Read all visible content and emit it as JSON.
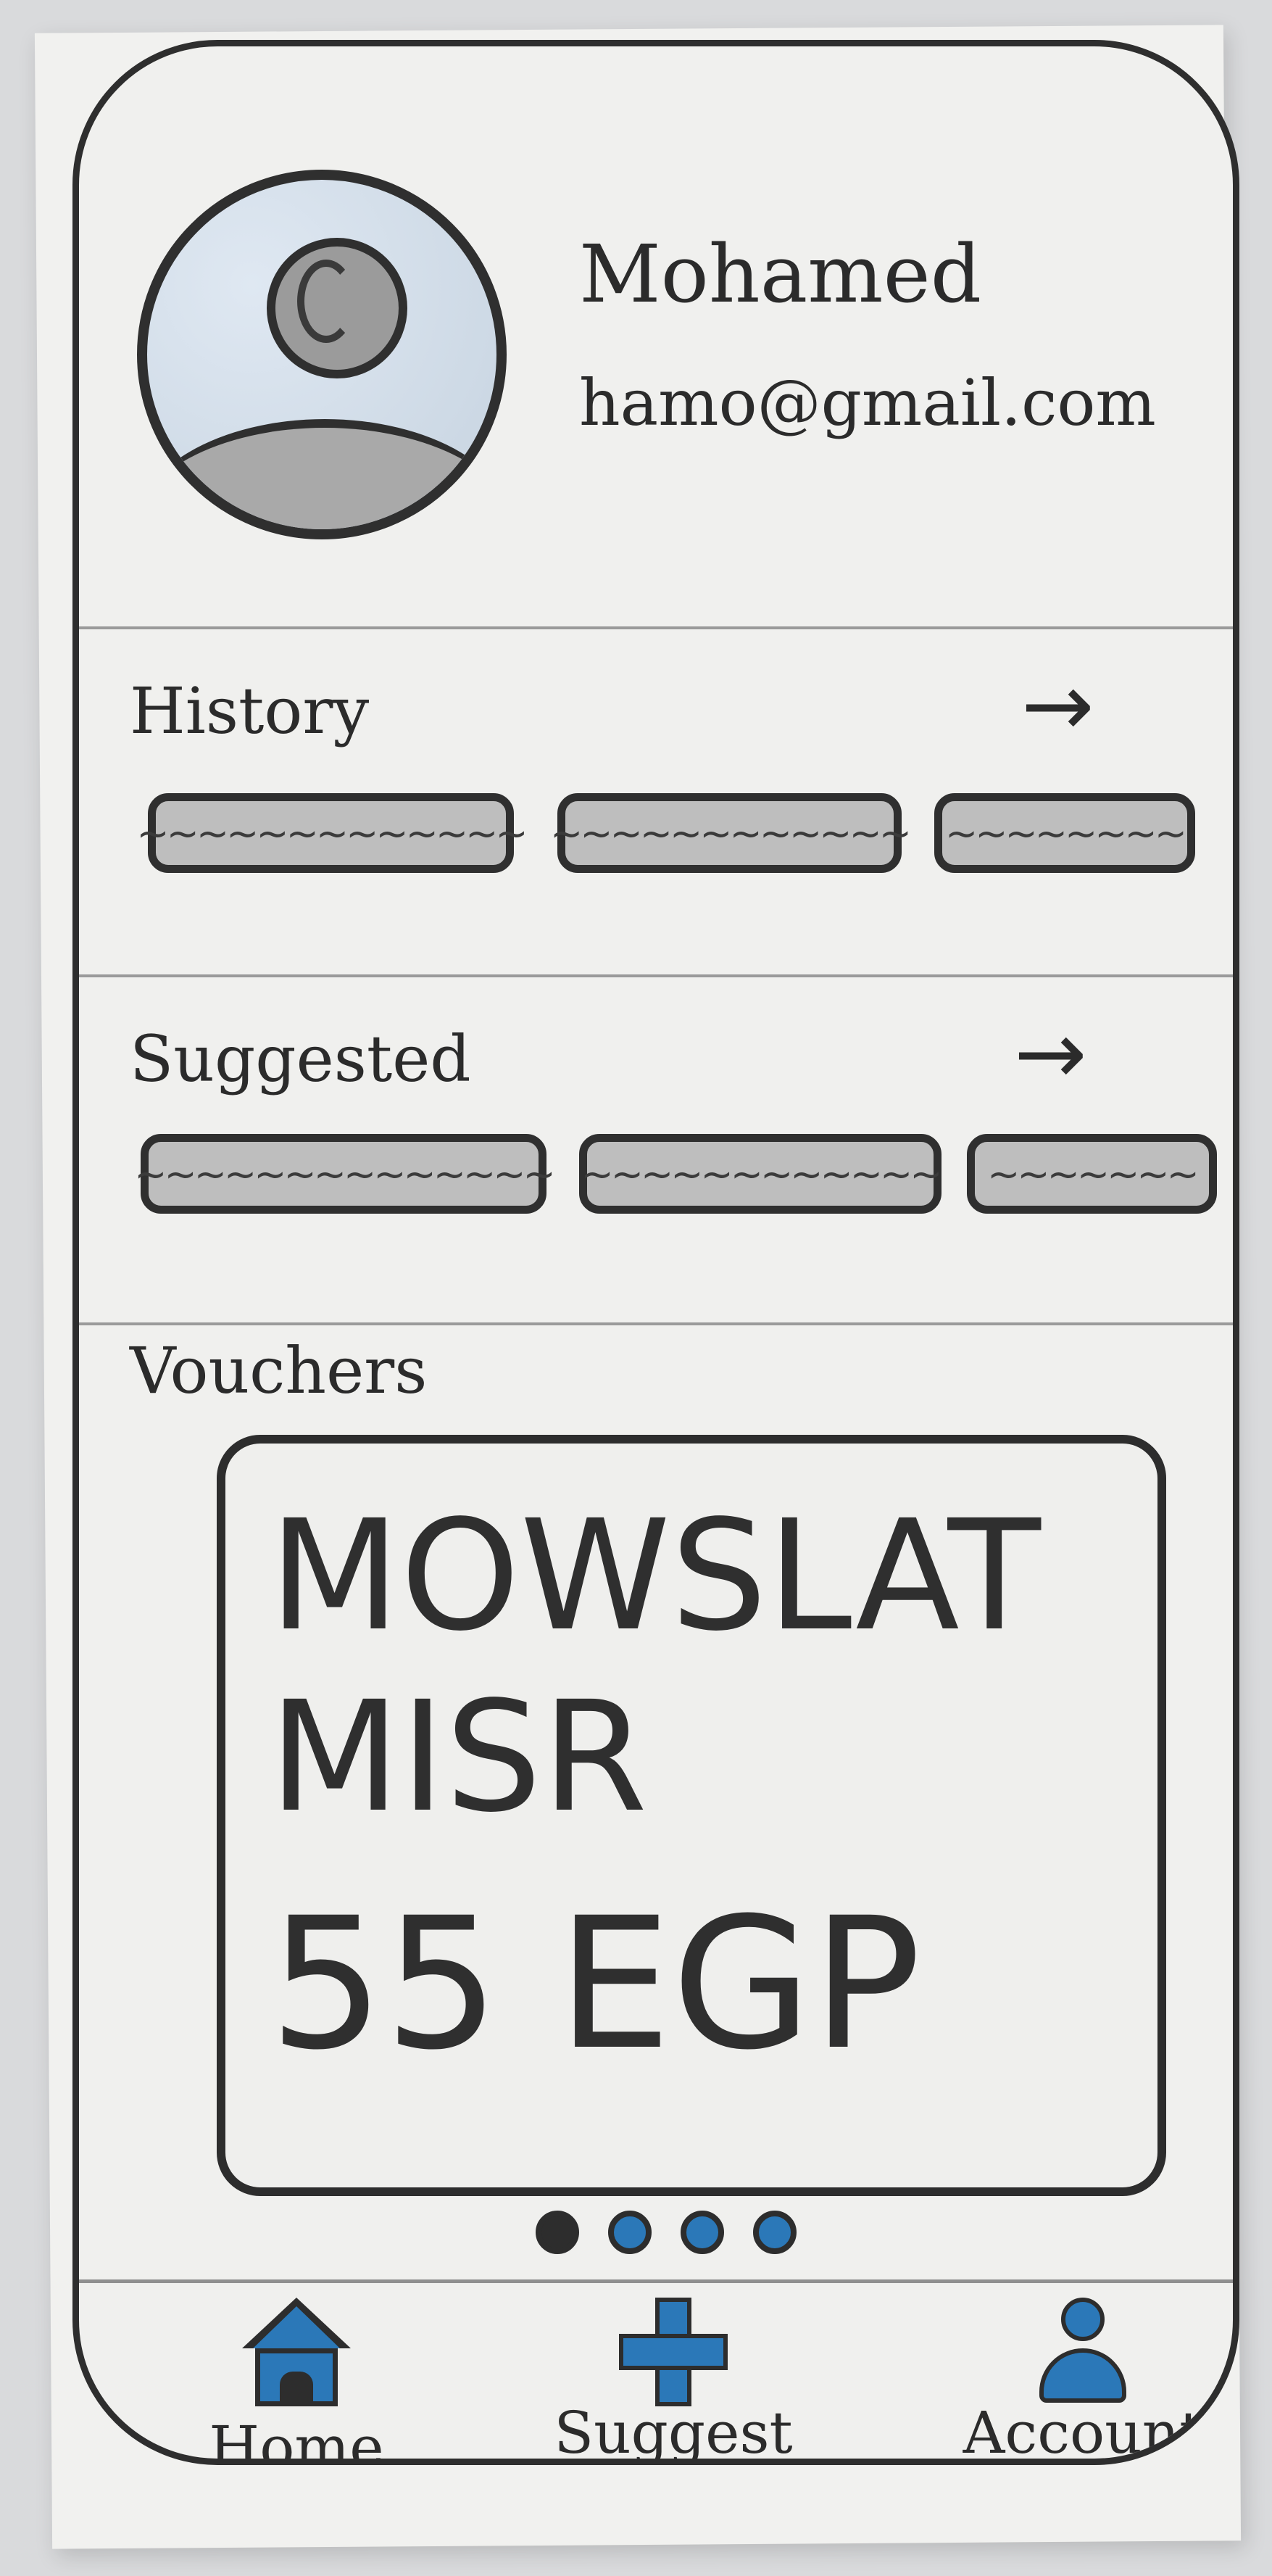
{
  "profile": {
    "name": "Mohamed",
    "email": "hamo@gmail.com"
  },
  "sections": {
    "history": {
      "title": "History",
      "arrow": "→"
    },
    "suggested": {
      "title": "Suggested",
      "arrow": "→"
    },
    "vouchers": {
      "title": "Vouchers"
    }
  },
  "voucher": {
    "line1": "MOWSLAT",
    "line2": "MISR",
    "line3": "55 EGP"
  },
  "carousel": {
    "count": 4,
    "active_index": 0
  },
  "nav": {
    "home": "Home",
    "suggest": "Suggest",
    "account": "Account"
  },
  "colors": {
    "accent": "#2b78b8",
    "ink": "#2d2d2d",
    "placeholder": "#bebebe"
  },
  "icons": [
    "user-avatar-icon",
    "arrow-right-icon",
    "home-icon",
    "plus-icon",
    "account-icon"
  ]
}
